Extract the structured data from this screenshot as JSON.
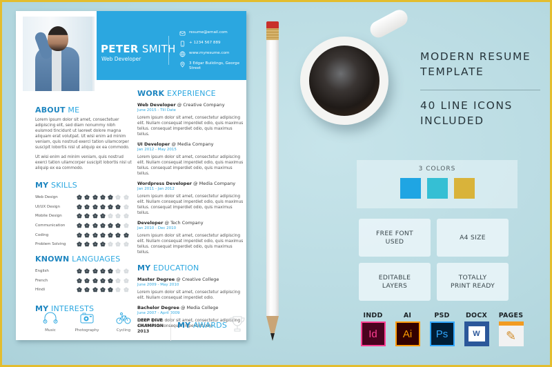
{
  "colors": {
    "accent": "#2ba7e0",
    "accent_dark": "#1f86c0",
    "frame_border": "#e3bd2e",
    "background": "#b9dbe2",
    "dot_filled": "#3e4a52",
    "dot_empty": "#d8dcdf"
  },
  "resume": {
    "first_name": "PETER",
    "last_name": "SMITH",
    "role": "Web Developer",
    "contacts": [
      {
        "icon": "email-icon",
        "text": "resume@email.com"
      },
      {
        "icon": "phone-icon",
        "text": "+ 1234 567 889"
      },
      {
        "icon": "globe-icon",
        "text": "www.myresume.com"
      },
      {
        "icon": "location-pin-icon",
        "text": "3 Edgar Buildings, George Street"
      }
    ],
    "about": {
      "title_bold": "ABOUT",
      "title_light": "ME",
      "paragraphs": [
        "Lorem ipsum dolor sit amet, consectetuer adipiscing elit, sed diam nonummy nibh euismod tincidunt ut laoreet dolore magna aliquam erat volutpat. Ut wisi enim ad minim veniam, quis nostrud exerci tation ullamcorper suscipit lobortis nisl ut aliquip ex ea commodo.",
        "Ut wisi enim ad minim veniam, quis nostrud exerci tation ullamcorper suscipit lobortis nisl ut aliquip ex ea commodo."
      ]
    },
    "skills": {
      "title_bold": "MY",
      "title_light": "SKILLS",
      "max": 7,
      "items": [
        {
          "name": "Web Design",
          "level": 5
        },
        {
          "name": "UI/UX Design",
          "level": 6
        },
        {
          "name": "Mobile Design",
          "level": 4
        },
        {
          "name": "Communication",
          "level": 6
        },
        {
          "name": "Coding",
          "level": 7
        },
        {
          "name": "Problem Solving",
          "level": 4
        }
      ]
    },
    "languages": {
      "title_bold": "KNOWN",
      "title_light": "LANGUAGES",
      "max": 7,
      "items": [
        {
          "name": "English",
          "level": 5
        },
        {
          "name": "French",
          "level": 5
        },
        {
          "name": "Hindi",
          "level": 5
        }
      ]
    },
    "interests": {
      "title_bold": "MY",
      "title_light": "INTERESTS",
      "items": [
        {
          "icon": "headphones-icon",
          "label": "Music"
        },
        {
          "icon": "camera-icon",
          "label": "Photography"
        },
        {
          "icon": "bicycle-icon",
          "label": "Cycling"
        }
      ]
    },
    "work": {
      "title_bold": "WORK",
      "title_light": "EXPERIENCE",
      "jobs": [
        {
          "title": "Web Developer",
          "company": "@ Creative Company",
          "dates": "June 2015 - Till Date",
          "desc": "Lorem ipsum dolor sit amet, consectetur adipiscing elit. Nullam consequat imperdiet odio, quis maximus tellus. consequat imperdiet odio, quis maximus tellus."
        },
        {
          "title": "UI Developer",
          "company": "@ Media Company",
          "dates": "Jan 2012 - May 2015",
          "desc": "Lorem ipsum dolor sit amet, consectetur adipiscing elit. Nullam consequat imperdiet odio, quis maximus tellus. consequat imperdiet odio, quis maximus tellus."
        },
        {
          "title": "Wordpress Developer",
          "company": "@ Media Company",
          "dates": "Jan 2011 - Jan 2012",
          "desc": "Lorem ipsum dolor sit amet, consectetur adipiscing elit. Nullam consequat imperdiet odio, quis maximus tellus. consequat imperdiet odio, quis maximus tellus."
        },
        {
          "title": "Developer",
          "company": "@ Tech Company",
          "dates": "Jan 2010 - Dec 2010",
          "desc": "Lorem ipsum dolor sit amet, consectetur adipiscing elit. Nullam consequat imperdiet odio, quis maximus tellus. consequat imperdiet odio, quis maximus tellus."
        }
      ]
    },
    "education": {
      "title_bold": "MY",
      "title_light": "EDUCATION",
      "items": [
        {
          "title": "Master Degree",
          "school": "@ Creative College",
          "dates": "June 2009 - May 2010",
          "desc": "Lorem ipsum dolor sit amet, consectetur adipiscing elit. Nullam consequat imperdiet odio."
        },
        {
          "title": "Bachelor Degree",
          "school": "@ Media College",
          "dates": "June 2007 - April 2009",
          "desc": "Lorem ipsum dolor sit amet, consectetur adipiscing elit. Nullam consequat imperdiet odio."
        }
      ]
    },
    "awards": {
      "title_bold": "MY",
      "title_light": "AWARDS",
      "award_text": "DEEP DIVE\nCHAMPION\n2013"
    }
  },
  "promo": {
    "title": "MODERN RESUME\nTEMPLATE",
    "subtitle": "40 LINE ICONS\nINCLUDED",
    "colors_label": "3 COLORS",
    "swatches": [
      "#1fa5e3",
      "#35bfd4",
      "#d9b33a"
    ],
    "features": [
      "FREE FONT\nUSED",
      "A4 SIZE",
      "EDITABLE\nLAYERS",
      "TOTALLY\nPRINT READY"
    ],
    "formats": [
      {
        "label": "INDD",
        "icon_text": "Id",
        "icon": "indesign-icon"
      },
      {
        "label": "AI",
        "icon_text": "Ai",
        "icon": "illustrator-icon"
      },
      {
        "label": "PSD",
        "icon_text": "Ps",
        "icon": "photoshop-icon"
      },
      {
        "label": "DOCX",
        "icon_text": "W",
        "icon": "word-icon"
      },
      {
        "label": "PAGES",
        "icon_text": "✎",
        "icon": "pages-icon"
      }
    ]
  }
}
